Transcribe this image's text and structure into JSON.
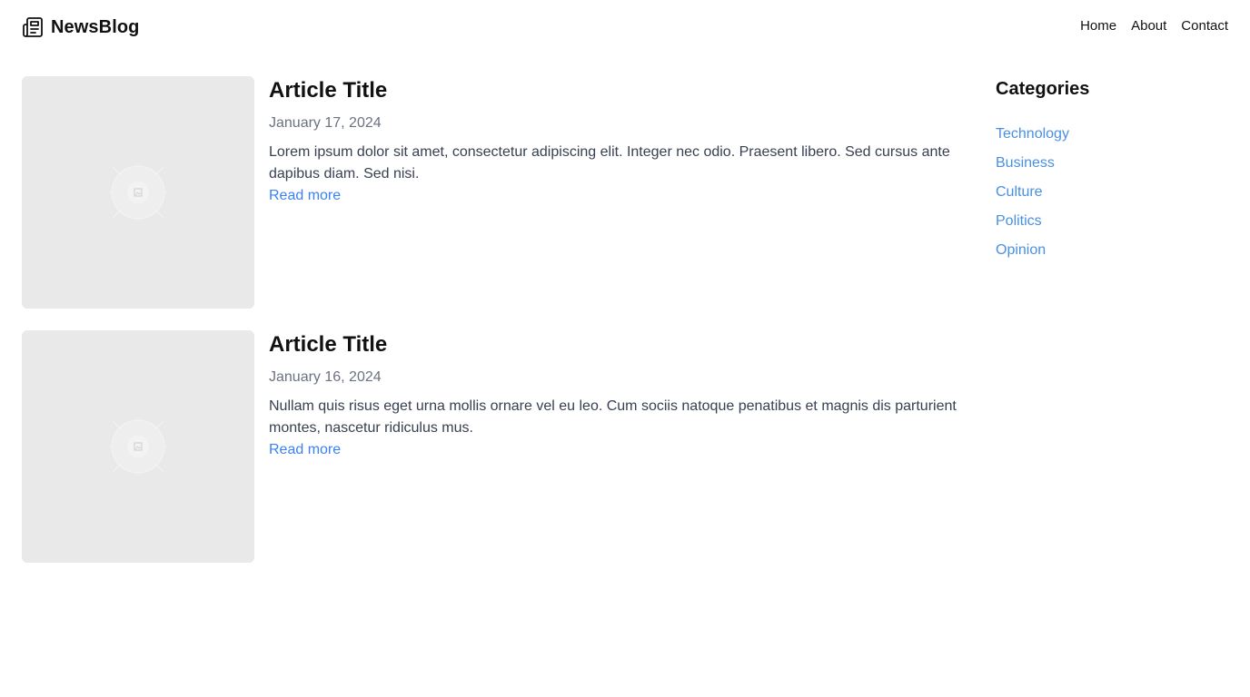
{
  "header": {
    "brand": "NewsBlog",
    "brand_icon": "newspaper-icon",
    "nav": [
      "Home",
      "About",
      "Contact"
    ]
  },
  "articles": [
    {
      "title": "Article Title",
      "date": "January 17, 2024",
      "excerpt": "Lorem ipsum dolor sit amet, consectetur adipiscing elit. Integer nec odio. Praesent libero. Sed cursus ante dapibus diam. Sed nisi.",
      "link": "Read more",
      "image_icon": "image-placeholder-icon"
    },
    {
      "title": "Article Title",
      "date": "January 16, 2024",
      "excerpt": "Nullam quis risus eget urna mollis ornare vel eu leo. Cum sociis natoque penatibus et magnis dis parturient montes, nascetur ridiculus mus.",
      "link": "Read more",
      "image_icon": "image-placeholder-icon"
    }
  ],
  "sidebar": {
    "title": "Categories",
    "categories": [
      "Technology",
      "Business",
      "Culture",
      "Politics",
      "Opinion"
    ]
  },
  "colors": {
    "link": "#4a90e2",
    "muted": "#6b7280",
    "thumb_bg": "#e9e9e9"
  }
}
